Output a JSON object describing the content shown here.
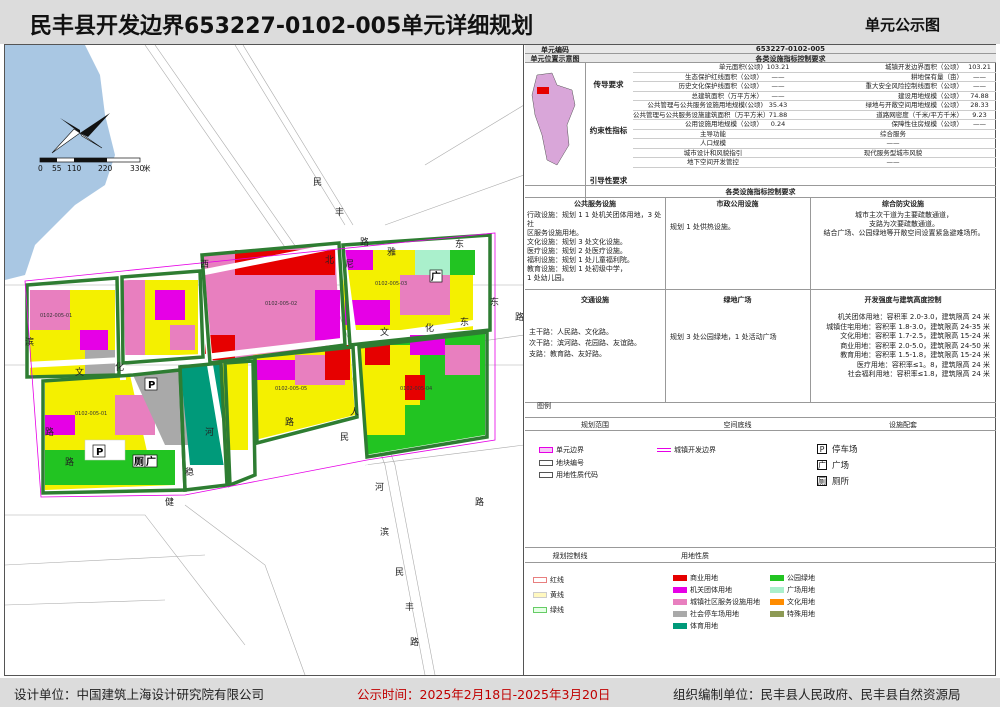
{
  "header": {
    "title": "民丰县开发边界653227-0102-005单元详细规划",
    "subtitle": "单元公示图"
  },
  "footer": {
    "designer": "设计单位：中国建筑上海设计研究院有限公司",
    "period": "公示时间：2025年2月18日-2025年3月20日",
    "org": "组织编制单位：民丰县人民政府、民丰县自然资源局"
  },
  "map": {
    "scale_ticks": [
      "0",
      "55",
      "110",
      "220",
      "330"
    ],
    "scale_unit": "米",
    "road_labels": [
      "民",
      "丰",
      "路",
      "尼",
      "雅",
      "东",
      "北",
      "西",
      "文",
      "化",
      "路",
      "东",
      "文",
      "化",
      "东",
      "路",
      "滨",
      "河",
      "路",
      "人",
      "民",
      "路",
      "河",
      "滨",
      "民",
      "丰",
      "路",
      "稳",
      "健",
      "路"
    ],
    "block_codes": [
      "0102-005-01",
      "0102-005-02",
      "0102-005-03",
      "0102-005-04",
      "0102-005-05",
      "0102-005-01"
    ],
    "icon_letters": [
      "P",
      "P",
      "厕",
      "广",
      "广"
    ]
  },
  "panel": {
    "unit_code_label": "单元编码",
    "unit_code": "653227-0102-005",
    "location_label": "单元位置示意图",
    "control_title": "各类设施指标控制要求",
    "group1": "传导要求",
    "group2": "约束性指标",
    "group3": "引导性要求",
    "r1": [
      "单元面积(公顷)",
      "103.21",
      "城镇开发边界面积（公顷）",
      "103.21"
    ],
    "r2": [
      "生态保护红线面积（公顷）",
      "——",
      "耕地保有量（亩）",
      "——"
    ],
    "r3": [
      "历史文化保护线面积（公顷）",
      "——",
      "重大安全风险控制线面积（公顷）",
      "——"
    ],
    "r4": [
      "总建筑面积（万平方米）",
      "——",
      "建设用地规模（公顷）",
      "74.88"
    ],
    "r5": [
      "公共管理与公共服务设施用地规模(公顷)",
      "35.43",
      "绿地与开敞空间用地规模（公顷）",
      "28.33"
    ],
    "r6": [
      "公共管理与公共服务设施建筑面积（万平方米）",
      "71.88",
      "道路网密度（千米/平方千米）",
      "9.23"
    ],
    "r7": [
      "公用设施用地规模（公顷）",
      "0.24",
      "保障性住房规模（公顷）",
      "——"
    ],
    "r8": [
      "主导功能",
      "综合服务"
    ],
    "r9": [
      "人口规模",
      "——"
    ],
    "r10": [
      "城市设计和风貌指引",
      "现代服务型城市风貌"
    ],
    "r11": [
      "地下空间开发管控",
      "——"
    ],
    "facility_title": "各类设施指标控制要求",
    "col_titles": [
      "公共服务设施",
      "市政公用设施",
      "综合防灾设施"
    ],
    "public_service": [
      "行政设施：规划 1 1 处机关团体用地，3 处社",
      "区服务设施用地。",
      "文化设施：规划 3 处文化设施。",
      "医疗设施：规划 2 处医疗设施。",
      "福利设施：规划 1 处儿童福利院。",
      "教育设施：规划 1 处初级中学，",
      "1 处幼儿园。"
    ],
    "municipal": [
      "规划 1 处供热设施。"
    ],
    "disaster": [
      "城市主次干道为主要疏散通道，",
      "支路为次要疏散通道。",
      "结合广场、公园绿地等开敞空间设置紧急避难场所。"
    ],
    "col_titles2": [
      "交通设施",
      "绿地广场",
      "开发强度与建筑高度控制"
    ],
    "traffic": [
      "主干路：人民路、文化路。",
      "次干路：滨河路、花园路、友谊路。",
      "支路：教育路、友好路。"
    ],
    "green": [
      "规划 3 处公园绿地，1 处活动广场"
    ],
    "intensity": [
      "机关团体用地：容积率 2.0-3.0，建筑限高 24 米",
      "城镇住宅用地：容积率 1.8-3.0，建筑限高 24-35 米",
      "文化用地：容积率 1.7-2.5，建筑限高 15-24 米",
      "商业用地：容积率 2.0-5.0，建筑限高 24-50 米",
      "教育用地：容积率 1.5-1.8，建筑限高 15-24 米",
      "医疗用地：容积率≤1。8，建筑限高 24 米",
      "社会福利用地：容积率≤1.8，建筑限高 24 米"
    ],
    "legend_title": "图例",
    "legend_cols": [
      "规划范围",
      "空间底线",
      "设施配套"
    ],
    "legend_scope": [
      "单元边界",
      "地块编号",
      "用地性质代码"
    ],
    "legend_bottom": "城镇开发边界",
    "facilities": [
      {
        "icon": "P",
        "label": "停车场"
      },
      {
        "icon": "广",
        "label": "广场"
      },
      {
        "icon": "厕",
        "label": "厕所"
      }
    ],
    "legend2_cols": [
      "规划控制线",
      "用地性质"
    ],
    "control_lines": [
      "红线",
      "黄线",
      "绿线"
    ],
    "landuse": [
      {
        "label": "商业用地",
        "color": "#e60000"
      },
      {
        "label": "公园绿地",
        "color": "#22c422"
      },
      {
        "label": "机关团体用地",
        "color": "#e600e6"
      },
      {
        "label": "广场用地",
        "color": "#aaf0cc"
      },
      {
        "label": "城镇社区服务设施用地",
        "color": "#e87fbf"
      },
      {
        "label": "文化用地",
        "color": "#ff8c00"
      },
      {
        "label": "社会停车场用地",
        "color": "#a9a9a9"
      },
      {
        "label": "特殊用地",
        "color": "#8d9a55"
      },
      {
        "label": "体育用地",
        "color": "#009a7a"
      }
    ]
  }
}
